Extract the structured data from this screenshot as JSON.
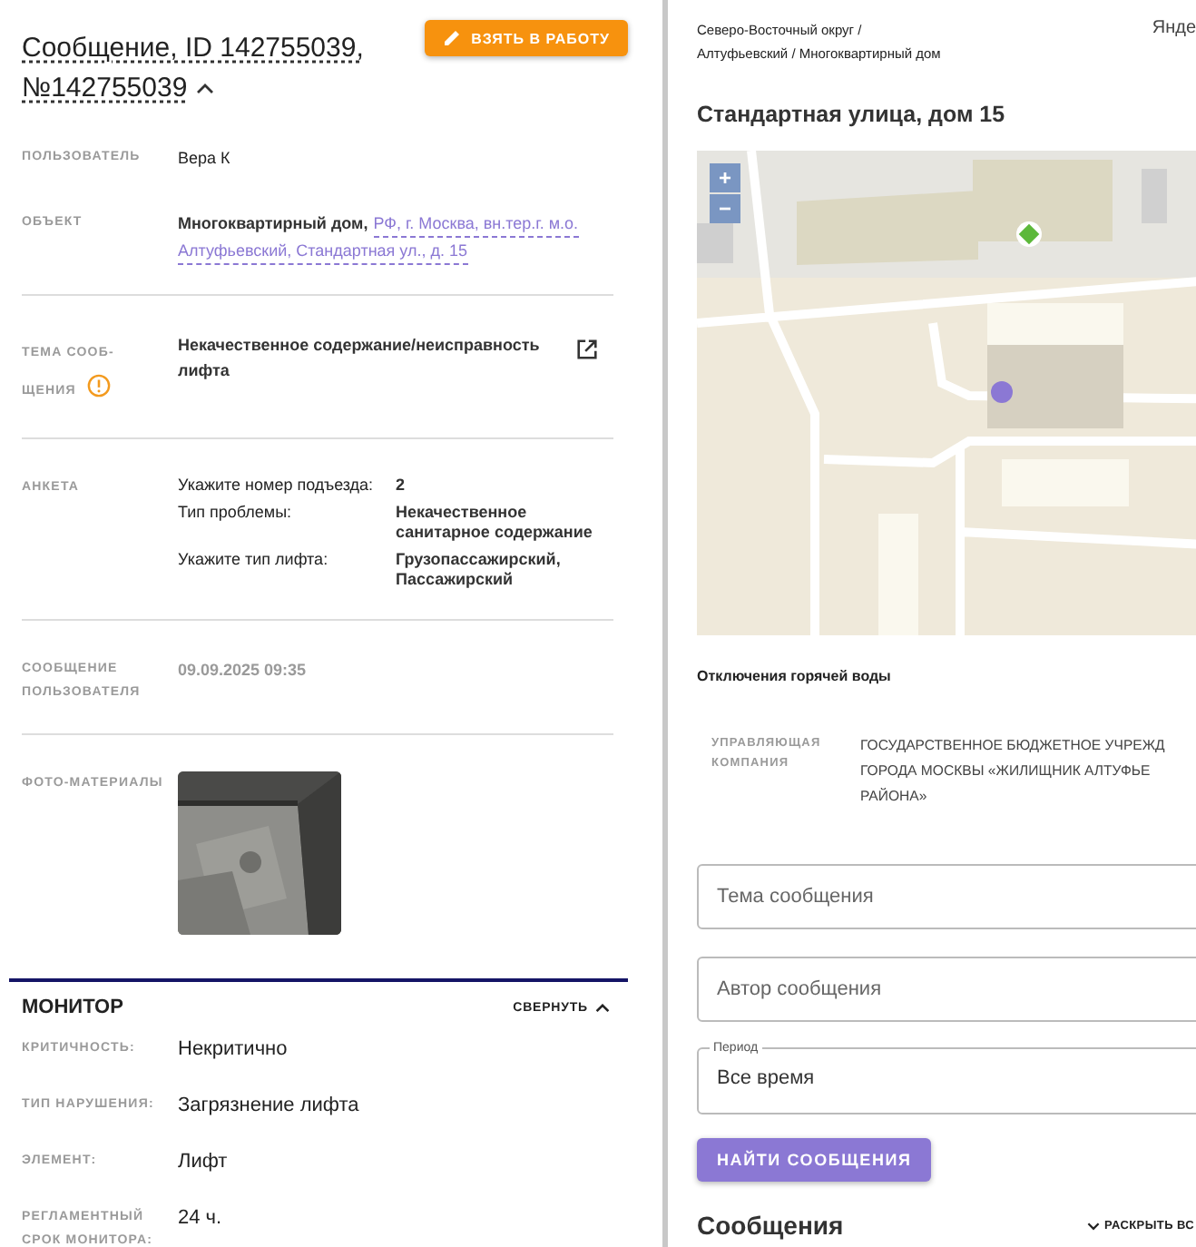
{
  "message": {
    "title_lines": [
      "Сообщение, ID 142755039,",
      "№142755039"
    ],
    "expanded": true,
    "action_button": "ВЗЯТЬ В РАБОТУ",
    "sections": [
      {
        "rows": [
          {
            "kind": "text",
            "label": "ПОЛЬЗОВАТЕЛЬ",
            "value": "Вера К"
          },
          {
            "kind": "object",
            "label": "ОБЪЕКТ",
            "value": "Многоквартирный дом,",
            "link_lines": [
              "РФ, г. Москва, вн.тер.г. м.о.",
              "Алтуфьевский, Стандартная ул., д. 15"
            ]
          }
        ]
      },
      {
        "rows": [
          {
            "kind": "topic",
            "label": "ТЕМА СООБ-ЩЕНИЯ",
            "value": "Некачественное содержание/неисправность лифта",
            "warning": true
          }
        ]
      },
      {
        "rows": [
          {
            "kind": "survey",
            "label": "АНКЕТА",
            "pairs": [
              {
                "question": "Укажите номер подъезда:",
                "answer": "2"
              },
              {
                "question": "Тип проблемы:",
                "answer": "Некачественное санитарное содержание"
              },
              {
                "question": "Укажите тип лифта:",
                "answer": "Грузопассажирский, Пассажирский"
              }
            ]
          }
        ]
      },
      {
        "rows": [
          {
            "kind": "date",
            "label": "СООБЩЕНИЕ ПОЛЬЗОВАТЕЛЯ",
            "value": "09.09.2025 09:35"
          }
        ]
      },
      {
        "rows": [
          {
            "label": "ФОТО-МАТЕРИАЛЫ"
          }
        ]
      }
    ]
  },
  "monitor": {
    "title": "МОНИТОР",
    "collapse_button": "СВЕРНУТЬ",
    "expanded": true,
    "rows": [
      {
        "label": "КРИТИЧНОСТЬ:",
        "value": "Некритично"
      },
      {
        "label": "ТИП НАРУШЕНИЯ:",
        "value": "Загрязнение лифта"
      },
      {
        "label": "ЭЛЕМЕНТ:",
        "value": "Лифт"
      },
      {
        "label": "РЕГЛАМЕНТНЫЙ СРОК МОНИТОРА:",
        "value": "24 ч."
      }
    ]
  },
  "building": {
    "breadcrumb": [
      "Северо-Восточный округ /",
      "Алтуфьевский / Многоквартирный дом"
    ],
    "corner_text": "Янде",
    "title": "Стандартная улица, дом 15",
    "map": {
      "zoom_in": "+",
      "zoom_out": "−"
    },
    "notice": "Отключения горячей воды",
    "company": {
      "label": "УПРАВЛЯЮЩАЯ КОМПАНИЯ",
      "lines": [
        "ГОСУДАРСТВЕННОЕ БЮДЖЕТНОЕ УЧРЕЖД",
        "ГОРОДА МОСКВЫ «ЖИЛИЩНИК АЛТУФЬЕ",
        "РАЙОНА»"
      ]
    }
  },
  "search": {
    "fields": [
      {
        "placeholder": "Тема сообщения"
      },
      {
        "placeholder": "Автор сообщения"
      },
      {
        "label": "Период",
        "value": "Все время"
      }
    ],
    "button": "НАЙТИ СООБЩЕНИЯ"
  },
  "messages": {
    "title": "Сообщения",
    "expand_all": "РАСКРЫТЬ ВС",
    "expanded": false
  }
}
